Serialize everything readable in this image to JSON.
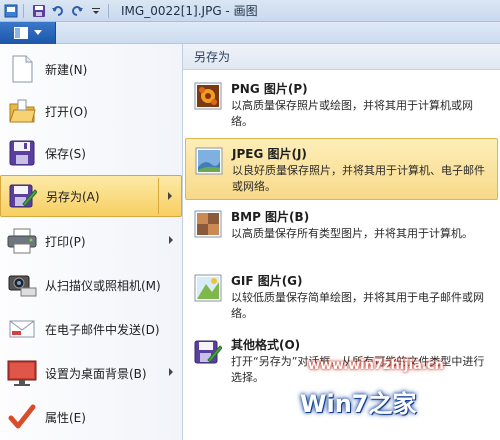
{
  "titlebar": {
    "title": "IMG_0022[1].JPG - 画图"
  },
  "left_menu": {
    "items": [
      {
        "label": "新建(N)",
        "icon": "new-file-icon"
      },
      {
        "label": "打开(O)",
        "icon": "open-folder-icon"
      },
      {
        "label": "保存(S)",
        "icon": "save-disk-icon"
      },
      {
        "label": "另存为(A)",
        "icon": "save-as-icon",
        "active": true
      },
      {
        "label": "打印(P)",
        "icon": "printer-icon"
      },
      {
        "label": "从扫描仪或照相机(M)",
        "icon": "scanner-icon"
      },
      {
        "label": "在电子邮件中发送(D)",
        "icon": "email-icon"
      },
      {
        "label": "设置为桌面背景(B)",
        "icon": "desktop-icon"
      },
      {
        "label": "属性(E)",
        "icon": "checkmark-icon"
      }
    ]
  },
  "submenu": {
    "header": "另存为",
    "items": [
      {
        "title": "PNG 图片(P)",
        "desc": "以高质量保存照片或绘图，并将其用于计算机或网络。",
        "icon": "png-image-icon"
      },
      {
        "title": "JPEG 图片(J)",
        "desc": "以良好质量保存照片，并将其用于计算机、电子邮件或网络。",
        "icon": "jpeg-image-icon",
        "active": true
      },
      {
        "title": "BMP 图片(B)",
        "desc": "以高质量保存所有类型图片，并将其用于计算机。",
        "icon": "bmp-image-icon"
      },
      {
        "title": "GIF 图片(G)",
        "desc": "以较低质量保存简单绘图，并将其用于电子邮件或网络。",
        "icon": "gif-image-icon"
      },
      {
        "title": "其他格式(O)",
        "desc": "打开“另存为”对话框，从所有可能的文件类型中进行选择。",
        "icon": "other-formats-icon"
      }
    ]
  },
  "watermark": {
    "url": "www.win7zhijia.cn",
    "text": "Win7之家"
  },
  "colors": {
    "highlight": "#f8d98a",
    "app_button": "#1c56a8"
  }
}
